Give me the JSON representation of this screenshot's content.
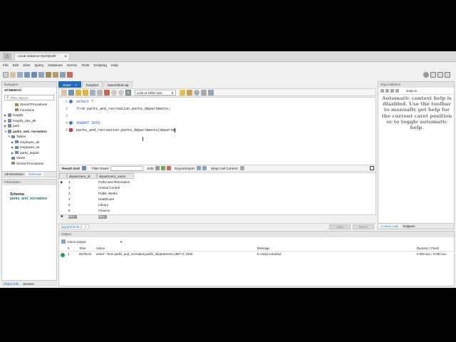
{
  "titlebar": {
    "home": "⌂",
    "tab": "Local instance MySQL80",
    "close": "×"
  },
  "menu": [
    "File",
    "Edit",
    "View",
    "Query",
    "Database",
    "Server",
    "Tools",
    "Scripting",
    "Help"
  ],
  "navigator": {
    "title": "Navigator",
    "schemas_label": "SCHEMAS",
    "filter_placeholder": "Filter objects",
    "tree": [
      {
        "label": "Stored Procedures",
        "depth": 2,
        "type": "fn",
        "caret": ""
      },
      {
        "label": "Functions",
        "depth": 2,
        "type": "fn",
        "caret": ""
      },
      {
        "label": "hospify",
        "depth": 0,
        "type": "db",
        "caret": "▶"
      },
      {
        "label": "hospify_dev_db",
        "depth": 0,
        "type": "db",
        "caret": "▶"
      },
      {
        "label": "park",
        "depth": 0,
        "type": "db",
        "caret": "▶"
      },
      {
        "label": "parks_and_recreation",
        "depth": 0,
        "type": "db",
        "caret": "▼"
      },
      {
        "label": "Tables",
        "depth": 1,
        "type": "tbl",
        "caret": "▼"
      },
      {
        "label": "employee_de",
        "depth": 2,
        "type": "tbl",
        "caret": "▶"
      },
      {
        "label": "employee_sa",
        "depth": 2,
        "type": "tbl",
        "caret": "▶"
      },
      {
        "label": "parks_depart",
        "depth": 2,
        "type": "tbl",
        "caret": "▶"
      },
      {
        "label": "Views",
        "depth": 1,
        "type": "tbl",
        "caret": ""
      },
      {
        "label": "Stored Procedures",
        "depth": 1,
        "type": "fn",
        "caret": ""
      }
    ],
    "bottom_tabs": [
      "Administration",
      "Schemas"
    ],
    "info_title": "Information",
    "schema_label": "Schema:",
    "schema_value": "parks_and_recreation",
    "footer_tabs": [
      "Object Info",
      "Session"
    ]
  },
  "editor": {
    "tabs": [
      "class*",
      "hospify3",
      "betechified.sql"
    ],
    "limit_label": "Limit to 1000 rows",
    "lines": [
      {
        "n": "1",
        "dot": "blue",
        "parts": [
          {
            "t": "select ",
            "k": true
          },
          {
            "t": "*",
            "k": false
          }
        ]
      },
      {
        "n": "2",
        "dot": "",
        "parts": [
          {
            "t": "from ",
            "k": true
          },
          {
            "t": "parks_and_recreation.parks_departments;",
            "k": false
          }
        ]
      },
      {
        "n": "3",
        "dot": "",
        "parts": []
      },
      {
        "n": "4",
        "dot": "blue",
        "parts": [
          {
            "t": "INSERT INTO",
            "k": true
          }
        ]
      },
      {
        "n": "5",
        "dot": "red",
        "parts": [
          {
            "t": "parks_and_recreation.parks_departments(departm",
            "k": false
          }
        ]
      }
    ]
  },
  "result": {
    "tab_label": "Result Grid",
    "filter_label": "Filter Rows:",
    "edit_label": "Edit:",
    "export_label": "Export/Import:",
    "wrap_label": "Wrap Cell Content:",
    "columns": [
      "department_id",
      "department_name"
    ],
    "rows": [
      [
        "1",
        "Parks and Recreation"
      ],
      [
        "2",
        "Animal Control"
      ],
      [
        "3",
        "Public Works"
      ],
      [
        "4",
        "Healthcare"
      ],
      [
        "5",
        "Library"
      ],
      [
        "6",
        "Finance"
      ]
    ],
    "null_label": "NULL",
    "bottom_tab": "departments 1",
    "apply": "Apply",
    "revert": "Revert"
  },
  "sqladd": {
    "title": "SQLAdditions",
    "jump": "Jump to",
    "help": "Automatic context help is disabled. Use the toolbar to manually get help for the current caret position or to toggle automatic help.",
    "tabs": [
      "Context Help",
      "Snippets"
    ]
  },
  "output": {
    "title": "Output",
    "select_label": "Action Output",
    "headers": {
      "num": "#",
      "time": "Time",
      "action": "Action",
      "message": "Message",
      "duration": "Duration / Fetch"
    },
    "row": {
      "num": "1",
      "time": "06:09:04",
      "action": "select * from parks_and_recreation.parks_departments LIMIT 0, 1000",
      "message": "6 row(s) returned",
      "duration": "0.063 sec / 0.000 sec"
    }
  }
}
